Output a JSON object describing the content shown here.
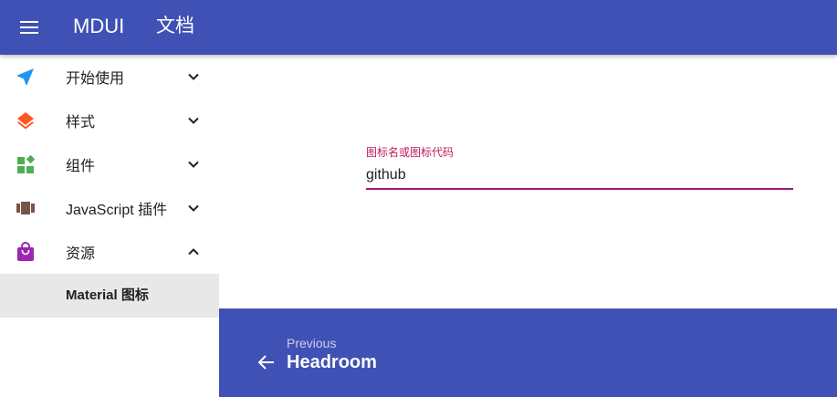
{
  "appbar": {
    "menu_icon": "menu-icon",
    "title": "MDUI",
    "subtitle": "文档"
  },
  "sidebar": {
    "items": [
      {
        "label": "开始使用",
        "icon": "navigation-icon",
        "icon_color": "#2196f3",
        "expanded": false
      },
      {
        "label": "样式",
        "icon": "layers-icon",
        "icon_color": "#ff5722",
        "expanded": false
      },
      {
        "label": "组件",
        "icon": "widgets-icon",
        "icon_color": "#4caf50",
        "expanded": false
      },
      {
        "label": "JavaScript 插件",
        "icon": "view-carousel-icon",
        "icon_color": "#795548",
        "expanded": false
      },
      {
        "label": "资源",
        "icon": "local-mall-icon",
        "icon_color": "#9c27b0",
        "expanded": true
      }
    ],
    "sub_item": {
      "label": "Material 图标",
      "active": true
    }
  },
  "search": {
    "label": "图标名或图标代码",
    "value": "github",
    "accent_color": "#c2185b"
  },
  "footer": {
    "caption": "Previous",
    "title": "Headroom",
    "icon": "arrow-back-icon"
  },
  "colors": {
    "primary": "#3f51b5",
    "accent": "#c2185b"
  }
}
